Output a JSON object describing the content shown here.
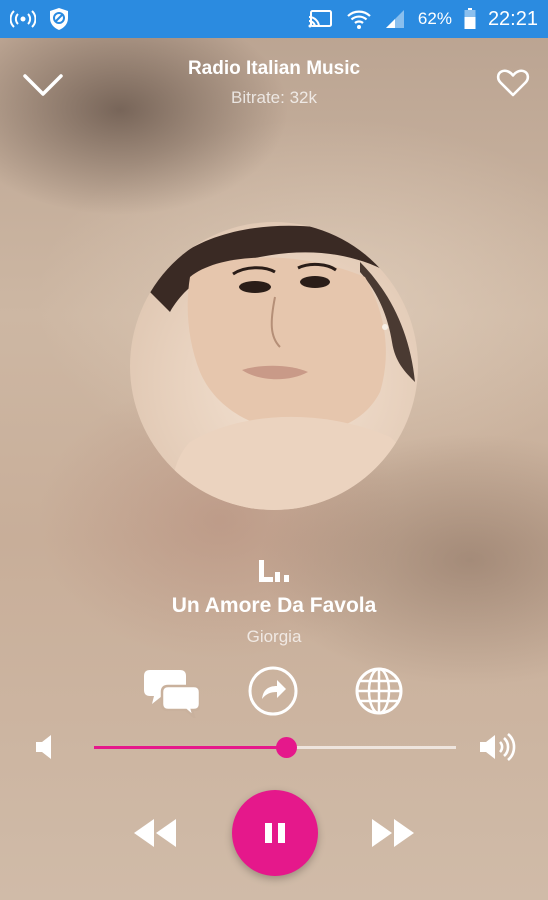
{
  "status_bar": {
    "battery": "62%",
    "time": "22:21",
    "color": "#2b8be0"
  },
  "header": {
    "title": "Radio Italian Music",
    "subtitle": "Bitrate: 32k"
  },
  "now_playing": {
    "song": "Un Amore Da Favola",
    "artist": "Giorgia"
  },
  "volume": {
    "level": 0.53
  },
  "icons": {
    "back": "chevron-down-icon",
    "favorite": "heart-icon",
    "equalizer": "equalizer-icon",
    "chat": "chat-icon",
    "share": "share-icon",
    "web": "globe-icon",
    "volume_low": "volume-low-icon",
    "volume_high": "volume-high-icon",
    "previous": "rewind-icon",
    "pause": "pause-icon",
    "next": "fast-forward-icon"
  },
  "colors": {
    "accent": "#e5188b",
    "status_bar": "#2b8be0",
    "text": "#ffffff"
  }
}
